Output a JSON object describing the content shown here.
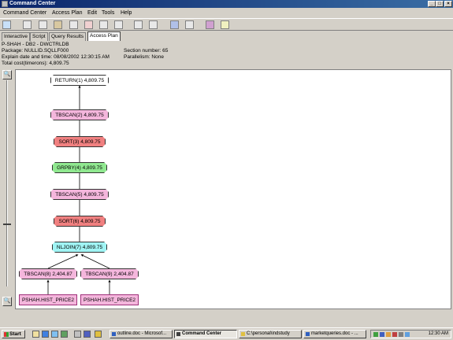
{
  "window": {
    "title": "Command Center"
  },
  "menu": [
    "Command Center",
    "Access Plan",
    "Edit",
    "Tools",
    "Help"
  ],
  "toolbar_icons": [
    "execute-icon",
    "open-icon",
    "save-icon",
    "db-icon",
    "history-icon",
    "chart-icon",
    "copy-icon",
    "paste-icon",
    "list-icon",
    "form-icon",
    "grid-icon",
    "tree-icon",
    "settings-icon",
    "help-icon"
  ],
  "tabs": [
    {
      "label": "Interactive",
      "active": false
    },
    {
      "label": "Script",
      "active": false
    },
    {
      "label": "Query Results",
      "active": false
    },
    {
      "label": "Access Plan",
      "active": true
    }
  ],
  "info": {
    "line1": "P-SHAH - DB2 - DWCTRLDB",
    "package": "Package: NULLID.SQLLF000",
    "section": "Section number: 65",
    "explain": "Explain date and time: 08/08/2002 12:30:15 AM",
    "parallelism": "Parallelism: None",
    "cost": "Total cost(timerons): 4,809.75"
  },
  "plan_nodes": {
    "return1": "RETURN(1) 4,809.75",
    "tbscan2": "TBSCAN(2) 4,809.75",
    "sort3": "SORT(3) 4,809.75",
    "grpby4": "GRPBY(4) 4,809.75",
    "tbscan5": "TBSCAN(5) 4,809.75",
    "sort6": "SORT(6) 4,809.75",
    "nljoin7": "NLJOIN(7) 4,809.75",
    "tbscan8": "TBSCAN(8) 2,404.87",
    "tbscan9": "TBSCAN(9) 2,404.87",
    "table_left": "PSHAH.HIST_PRICE2",
    "table_right": "PSHAH.HIST_PRICE2"
  },
  "colors": {
    "return": "#ffffff",
    "tbscan": "#f4b6dc",
    "sort": "#f08080",
    "grpby": "#90e890",
    "nljoin": "#a0f4f4",
    "table": "#f4b6dc"
  },
  "taskbar": {
    "start": "Start",
    "buttons": [
      {
        "label": "outline.doc - Microsof...",
        "active": false
      },
      {
        "label": "Command Center",
        "active": true
      },
      {
        "label": "C:\\personal\\indstudy",
        "active": false
      },
      {
        "label": "marketqueries.doc - ...",
        "active": false
      }
    ],
    "clock": "12:30 AM"
  }
}
